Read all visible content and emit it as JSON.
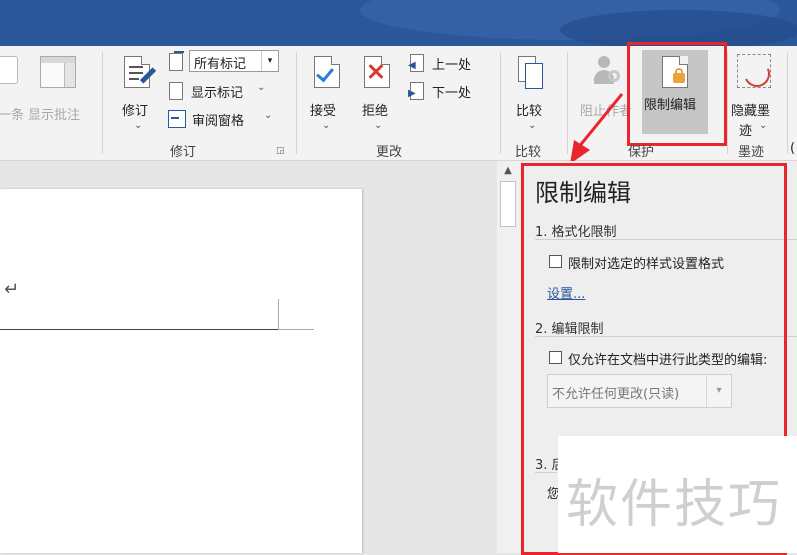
{
  "ribbon": {
    "prev_label": "一条",
    "show_comments_label": "显示批注",
    "track_changes_label": "修订",
    "markup_value": "所有标记",
    "show_markup_label": "显示标记",
    "review_pane_label": "审阅窗格",
    "group_tracking": "修订",
    "accept_label": "接受",
    "reject_label": "拒绝",
    "previous_change_label": "上一处",
    "next_change_label": "下一处",
    "group_changes": "更改",
    "compare_label": "比较",
    "group_compare": "比较",
    "block_authors_label": "阻止作者",
    "restrict_editing_label": "限制编辑",
    "group_protect": "保护",
    "hide_ink_label_line1": "隐藏墨",
    "hide_ink_label_line2": "迹",
    "group_ink": "墨迹",
    "edge_char": "("
  },
  "document": {
    "paragraph_mark": "↵"
  },
  "pane": {
    "title": "限制编辑",
    "section1_title": "1. 格式化限制",
    "section1_checkbox": "限制对选定的样式设置格式",
    "section1_link": "设置...",
    "section2_title": "2. 编辑限制",
    "section2_checkbox": "仅允许在文档中进行此类型的编辑:",
    "section2_select": "不允许任何更改(只读)",
    "section3_title": "3. 后",
    "section3_text": "您"
  },
  "watermark": {
    "text": "软件技巧"
  },
  "colors": {
    "title_bar": "#2b579a",
    "highlight": "#e8262c",
    "link": "#2b579a"
  }
}
